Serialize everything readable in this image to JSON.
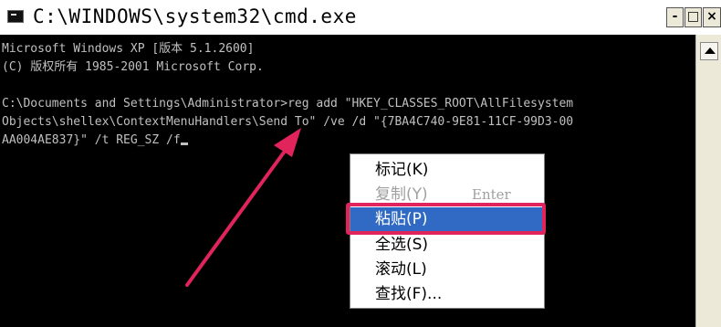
{
  "window": {
    "title": "C:\\WINDOWS\\system32\\cmd.exe",
    "buttons": {
      "minimize": "-",
      "maximize": "□",
      "close": "×"
    }
  },
  "console": {
    "lines": [
      "Microsoft Windows XP [版本 5.1.2600]",
      "(C) 版权所有 1985-2001 Microsoft Corp.",
      "",
      "C:\\Documents and Settings\\Administrator>reg add \"HKEY_CLASSES_ROOT\\AllFilesystem",
      "Objects\\shellex\\ContextMenuHandlers\\Send To\" /ve /d \"{7BA4C740-9E81-11CF-99D3-00",
      "AA004AE837}\" /t REG_SZ /f"
    ]
  },
  "context_menu": {
    "items": [
      {
        "label": "标记(K)",
        "accelerator": "",
        "disabled": false,
        "selected": false
      },
      {
        "label": "复制(Y)",
        "accelerator": "Enter",
        "disabled": true,
        "selected": false
      },
      {
        "label": "粘贴(P)",
        "accelerator": "",
        "disabled": false,
        "selected": true
      },
      {
        "label": "全选(S)",
        "accelerator": "",
        "disabled": false,
        "selected": false
      },
      {
        "label": "滚动(L)",
        "accelerator": "",
        "disabled": false,
        "selected": false
      },
      {
        "label": "查找(F)...",
        "accelerator": "",
        "disabled": false,
        "selected": false
      }
    ]
  },
  "colors": {
    "console_bg": "#000000",
    "console_text": "#c0c0c0",
    "selection": "#316ac5",
    "annotation": "#e2245c"
  }
}
